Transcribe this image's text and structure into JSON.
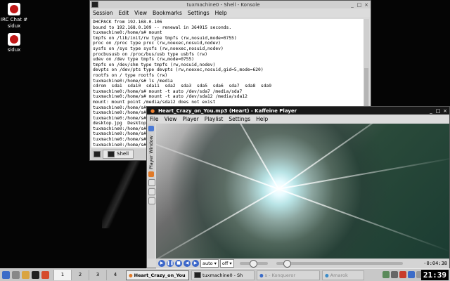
{
  "desktop": {
    "icons": [
      {
        "label": "IRC Chat #\nsidux"
      },
      {
        "label": "sidux"
      }
    ]
  },
  "konsole": {
    "title": "tuxmachine0 - Shell - Konsole",
    "menu": [
      "Session",
      "Edit",
      "View",
      "Bookmarks",
      "Settings",
      "Help"
    ],
    "lines": [
      "DHCPACK from 192.168.0.106",
      "bound to 192.168.0.109 -- renewal in 364915 seconds.",
      "tuxmachine0:/home/s# mount",
      "tmpfs on /lib/init/rw type tmpfs (rw,nosuid,mode=0755)",
      "proc on /proc type proc (rw,noexec,nosuid,nodev)",
      "sysfs on /sys type sysfs (rw,noexec,nosuid,nodev)",
      "procbususb on /proc/bus/usb type usbfs (rw)",
      "udev on /dev type tmpfs (rw,mode=0755)",
      "tmpfs on /dev/shm type tmpfs (rw,nosuid,nodev)",
      "devpts on /dev/pts type devpts (rw,noexec,nosuid,gid=5,mode=620)",
      "rootfs on / type rootfs (rw)",
      "tuxmachine0:/home/s# ls /media",
      "cdrom  sda1  sda10  sda11  sda2  sda3  sda5  sda6  sda7  sda8  sda9",
      "tuxmachine0:/home/s# mount -t auto /dev/sda7 /media/sda7",
      "tuxmachine0:/home/s# mount -t auto /dev/sda12 /media/sda12",
      "mount: mount point /media/sda12 does not exist",
      "tuxmachine0:/home/s# m",
      "tuxmachine0:/home/s# m",
      "tuxmachine0:/home/s# l",
      "desktop.jpg  Desktop",
      "tuxmachine0:/home/s# u",
      "tuxmachine0:/home/s# m",
      "tuxmachine0:/home/s# c",
      "tuxmachine0:/home/s# "
    ],
    "tab_label": "Shell"
  },
  "kaffeine": {
    "title": "Heart_Crazy_on_You.mp3 (Heart) - Kaffeine Player",
    "menu": [
      "File",
      "View",
      "Player",
      "Playlist",
      "Settings",
      "Help"
    ],
    "side_label": "Player Window",
    "aspect_select": "auto",
    "subtitle_select": "off",
    "time": "-0:04:38",
    "position_fraction": 0.06,
    "volume_fraction": 0.45
  },
  "taskbar": {
    "desktops": [
      "1",
      "2",
      "3",
      "4"
    ],
    "active_desktop": 0,
    "tasks": [
      {
        "label": "Heart_Crazy_on_You",
        "active": true
      },
      {
        "label": "tuxmachine0 - Sh",
        "active": false
      },
      {
        "label": "s - Konqueror",
        "active": false
      },
      {
        "label": "Amarok",
        "active": false
      }
    ],
    "clock": "21:39"
  }
}
